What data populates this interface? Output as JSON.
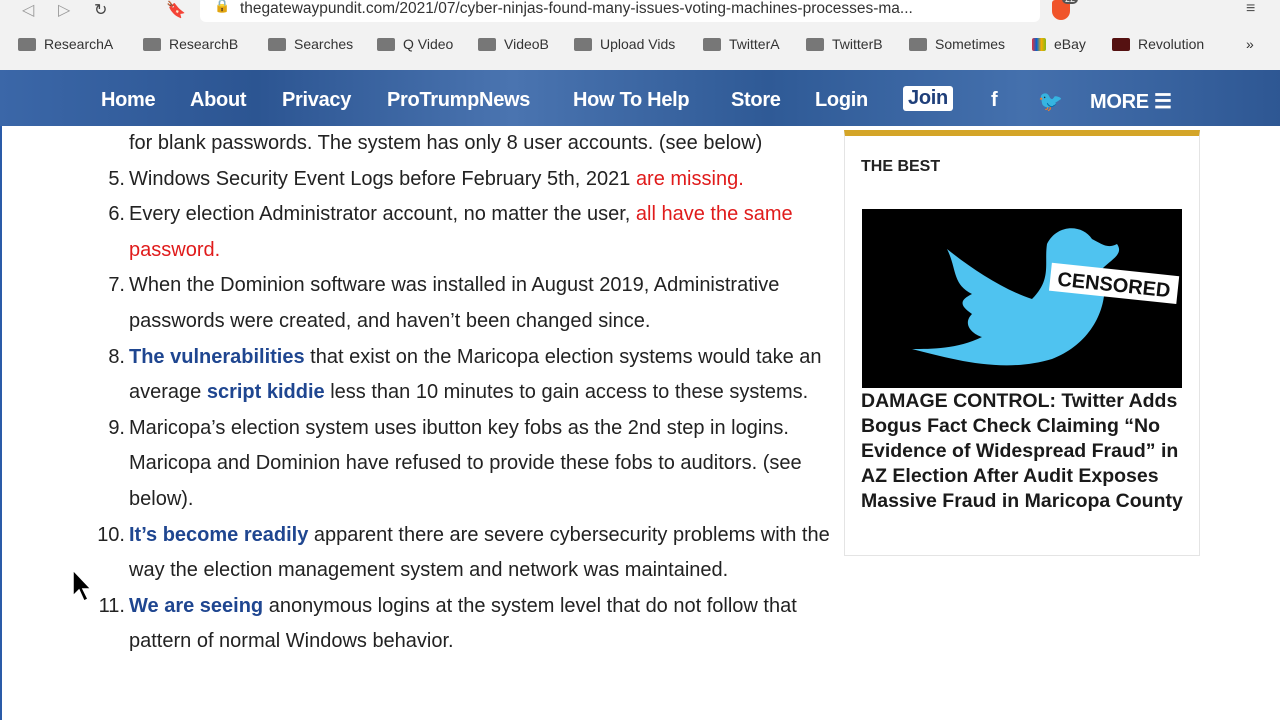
{
  "browser": {
    "url": "thegatewaypundit.com/2021/07/cyber-ninjas-found-many-issues-voting-machines-processes-ma...",
    "shield_count": "22",
    "bookmarks": [
      "ResearchA",
      "ResearchB",
      "Searches",
      "Q Video",
      "VideoB",
      "Upload Vids",
      "TwitterA",
      "TwitterB",
      "Sometimes",
      "eBay",
      "Revolution"
    ],
    "more": "»"
  },
  "nav": {
    "items": [
      "Home",
      "About",
      "Privacy",
      "ProTrumpNews",
      "How To Help",
      "Store",
      "Login"
    ],
    "join": "Join",
    "more": "MORE ☰",
    "accent": "#2c5592"
  },
  "article": {
    "items": [
      {
        "num": "",
        "segs": [
          {
            "t": "for blank passwords. The system has only 8 user accounts. (see below)",
            "s": "n"
          }
        ]
      },
      {
        "num": "5.",
        "segs": [
          {
            "t": "Windows Security Event Logs before February 5th, 2021 ",
            "s": "n"
          },
          {
            "t": "are missing.",
            "s": "r"
          }
        ]
      },
      {
        "num": "6.",
        "segs": [
          {
            "t": "Every election Administrator account, no matter the user, ",
            "s": "n"
          },
          {
            "t": "all have the same password.",
            "s": "r"
          }
        ]
      },
      {
        "num": "7.",
        "segs": [
          {
            "t": "When the Dominion software was installed in August 2019, Administrative passwords were created, and haven’t been changed since.",
            "s": "n"
          }
        ]
      },
      {
        "num": "8.",
        "segs": [
          {
            "t": "The vulnerabilities",
            "s": "l"
          },
          {
            "t": " that exist on the Maricopa election systems would take an average ",
            "s": "n"
          },
          {
            "t": "script kiddie",
            "s": "l"
          },
          {
            "t": " less than 10 minutes to gain access to these systems.",
            "s": "n"
          }
        ]
      },
      {
        "num": "9.",
        "segs": [
          {
            "t": "Maricopa’s election system uses ibutton key fobs as the 2nd step in logins. Maricopa and Dominion have refused to provide these fobs to auditors. (see below).",
            "s": "n"
          }
        ]
      },
      {
        "num": "10.",
        "segs": [
          {
            "t": "It’s become readily",
            "s": "l"
          },
          {
            "t": " apparent there are severe cybersecurity problems with the way the election management system and network was maintained.",
            "s": "n"
          }
        ]
      },
      {
        "num": "11.",
        "segs": [
          {
            "t": "We are seeing",
            "s": "l"
          },
          {
            "t": " anonymous logins at the system level that do not follow that pattern of normal Windows behavior.",
            "s": "n"
          }
        ]
      }
    ],
    "link_color": "#1f4690",
    "highlight_color": "#e01b1b"
  },
  "sidebar": {
    "section": "THE BEST",
    "image_text": "CENSORED",
    "headline": "DAMAGE CONTROL: Twitter Adds Bogus Fact Check Claiming “No Evidence of Widespread Fraud” in AZ Election After Audit Exposes Massive Fraud in Maricopa County",
    "accent": "#d4a528"
  }
}
